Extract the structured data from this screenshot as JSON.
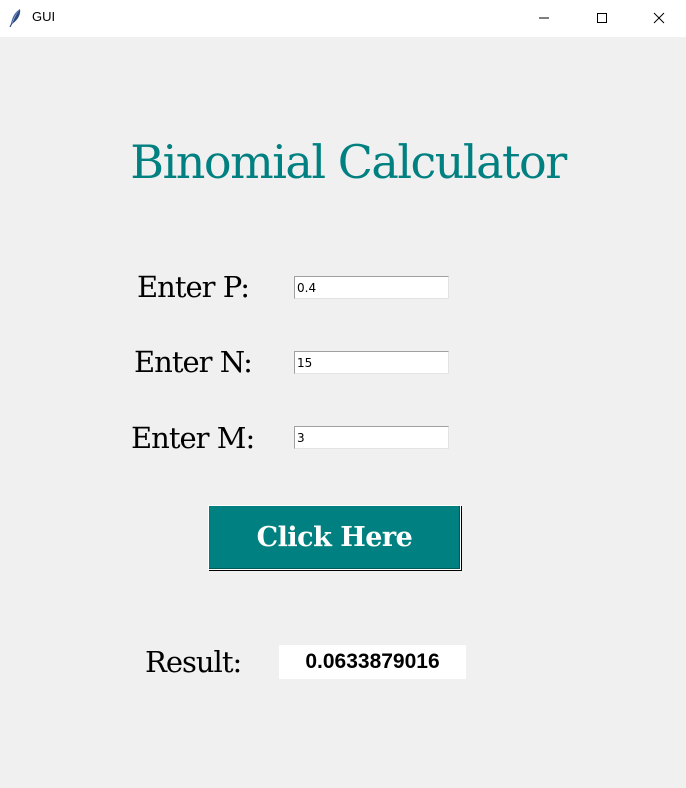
{
  "window": {
    "title": "GUI",
    "icons": {
      "app": "feather-icon",
      "minimize": "minimize-icon",
      "maximize": "maximize-icon",
      "close": "close-icon"
    }
  },
  "main": {
    "heading": "Binomial Calculator",
    "fields": [
      {
        "label": "Enter P:",
        "value": "0.4"
      },
      {
        "label": "Enter N:",
        "value": "15"
      },
      {
        "label": "Enter M:",
        "value": "3"
      }
    ],
    "button_label": "Click Here",
    "result_label": "Result:",
    "result_value": "0.0633879016"
  },
  "colors": {
    "accent": "#008080",
    "background": "#f0f0f0",
    "titlebar": "#ffffff"
  }
}
